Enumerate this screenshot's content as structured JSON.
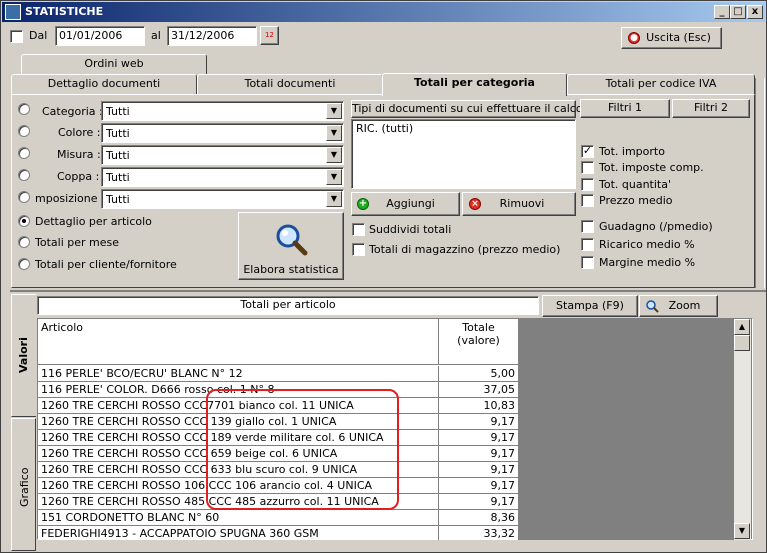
{
  "window": {
    "title": "STATISTICHE",
    "min": "_",
    "max": "□",
    "close": "x"
  },
  "filter": {
    "dal_label": "Dal",
    "date_from": "01/01/2006",
    "al_label": "al",
    "date_to": "31/12/2006",
    "calendar_text": "12"
  },
  "exit_button": "Uscita (Esc)",
  "tabs": {
    "ordini_web": "Ordini web",
    "dettaglio": "Dettaglio documenti",
    "totali_doc": "Totali documenti",
    "totali_cat": "Totali per categoria",
    "totali_iva": "Totali per codice IVA"
  },
  "criteria": [
    {
      "label": "Categoria :",
      "value": "Tutti"
    },
    {
      "label": "Colore :",
      "value": "Tutti"
    },
    {
      "label": "Misura :",
      "value": "Tutti"
    },
    {
      "label": "Coppa :",
      "value": "Tutti"
    },
    {
      "label": "mposizione :",
      "value": "Tutti"
    }
  ],
  "modes": {
    "dettaglio_articolo": "Dettaglio per articolo",
    "totali_mese": "Totali per mese",
    "totali_cliente": "Totali per cliente/fornitore"
  },
  "elabora_button": "Elabora statistica",
  "doc_types": {
    "header": "Tipi di documenti su cui effettuare il calcolo",
    "items": [
      "RIC. (tutti)"
    ],
    "add_button": "Aggiungi",
    "remove_button": "Rimuovi",
    "suddividi": "Suddividi totali",
    "magazzino": "Totali di magazzino (prezzo medio)"
  },
  "filters": {
    "filtri1": "Filtri 1",
    "filtri2": "Filtri 2"
  },
  "totals_options": [
    {
      "label": "Tot. importo",
      "checked": true
    },
    {
      "label": "Tot. imposte comp.",
      "checked": false
    },
    {
      "label": "Tot. quantita'",
      "checked": false
    },
    {
      "label": "Prezzo medio",
      "checked": false
    }
  ],
  "margin_options": [
    {
      "label": "Guadagno (/pmedio)",
      "checked": false
    },
    {
      "label": "Ricarico medio %",
      "checked": false
    },
    {
      "label": "Margine medio %",
      "checked": false
    }
  ],
  "results": {
    "title": "Totali per articolo",
    "stampa_button": "Stampa (F9)",
    "zoom_button": "Zoom",
    "side_tab_valori": "Valori",
    "side_tab_grafico": "Grafico",
    "col_articolo": "Articolo",
    "col_totale_line1": "Totale",
    "col_totale_line2": "(valore)",
    "rows": [
      {
        "articolo": "116 PERLE' BCO/ECRU' BLANC N° 12",
        "totale": "5,00"
      },
      {
        "articolo": "116 PERLE' COLOR. D666 rosso col. 1 N° 8",
        "totale": "37,05"
      },
      {
        "articolo": "1260 TRE CERCHI ROSSO CCC7701 bianco col. 11 UNICA",
        "totale": "10,83"
      },
      {
        "articolo": "1260 TRE CERCHI ROSSO CCC 139 giallo col. 1 UNICA",
        "totale": "9,17"
      },
      {
        "articolo": "1260 TRE CERCHI ROSSO CCC 189 verde militare col. 6 UNICA",
        "totale": "9,17"
      },
      {
        "articolo": "1260 TRE CERCHI ROSSO CCC 659 beige col. 6 UNICA",
        "totale": "9,17"
      },
      {
        "articolo": "1260 TRE CERCHI ROSSO CCC 633 blu scuro col. 9 UNICA",
        "totale": "9,17"
      },
      {
        "articolo": "1260 TRE CERCHI ROSSO 106 CCC 106 arancio col. 4 UNICA",
        "totale": "9,17"
      },
      {
        "articolo": "1260 TRE CERCHI ROSSO 485 CCC 485 azzurro col. 11 UNICA",
        "totale": "9,17"
      },
      {
        "articolo": "151 CORDONETTO BLANC N° 60",
        "totale": "8,36"
      },
      {
        "articolo": "FEDERIGHI4913 - ACCAPPATOIO SPUGNA 360 GSM",
        "totale": "33,32"
      }
    ]
  }
}
